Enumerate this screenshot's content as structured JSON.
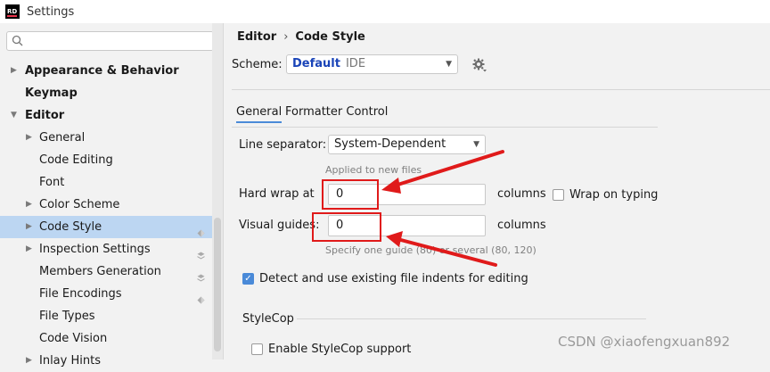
{
  "window": {
    "title": "Settings",
    "logo_text": "RD"
  },
  "search": {
    "placeholder": ""
  },
  "sidebar": {
    "items": [
      {
        "label": "Appearance & Behavior",
        "level": 0,
        "expandable": true,
        "expanded": false
      },
      {
        "label": "Keymap",
        "level": 0,
        "expandable": false
      },
      {
        "label": "Editor",
        "level": 0,
        "expandable": true,
        "expanded": true
      },
      {
        "label": "General",
        "level": 1,
        "expandable": true
      },
      {
        "label": "Code Editing",
        "level": 1,
        "expandable": false
      },
      {
        "label": "Font",
        "level": 1,
        "expandable": false
      },
      {
        "label": "Color Scheme",
        "level": 1,
        "expandable": true
      },
      {
        "label": "Code Style",
        "level": 1,
        "expandable": true,
        "selected": true,
        "badge": "diamond-icon"
      },
      {
        "label": "Inspection Settings",
        "level": 1,
        "expandable": true,
        "badge": "layers-icon"
      },
      {
        "label": "Members Generation",
        "level": 1,
        "expandable": false,
        "badge": "layers-icon"
      },
      {
        "label": "File Encodings",
        "level": 1,
        "expandable": false,
        "badge": "diamond-icon"
      },
      {
        "label": "File Types",
        "level": 1,
        "expandable": false
      },
      {
        "label": "Code Vision",
        "level": 1,
        "expandable": false
      },
      {
        "label": "Inlay Hints",
        "level": 1,
        "expandable": true
      }
    ]
  },
  "breadcrumb": {
    "parent": "Editor",
    "separator": "›",
    "current": "Code Style"
  },
  "scheme": {
    "label": "Scheme:",
    "name": "Default",
    "kind": "IDE"
  },
  "tabs": [
    {
      "label": "General",
      "active": true
    },
    {
      "label": "Formatter Control",
      "active": false
    }
  ],
  "form": {
    "line_separator": {
      "label": "Line separator:",
      "value": "System-Dependent",
      "hint": "Applied to new files"
    },
    "hard_wrap": {
      "label": "Hard wrap at",
      "value": "0",
      "unit": "columns"
    },
    "wrap_on_typing": {
      "label": "Wrap on typing",
      "checked": false
    },
    "visual_guides": {
      "label": "Visual guides:",
      "value": "0",
      "unit": "columns",
      "hint": "Specify one guide (80) or several (80, 120)"
    },
    "detect_indents": {
      "label": "Detect and use existing file indents for editing",
      "checked": true
    },
    "stylecop": {
      "section": "StyleCop",
      "label": "Enable StyleCop support",
      "checked": false
    }
  },
  "watermark": "CSDN @xiaofengxuan892",
  "colors": {
    "selection": "#bcd6f2",
    "accent": "#4a8ad8",
    "scheme_name": "#1a44b8",
    "annotation": "#e01a1a"
  }
}
